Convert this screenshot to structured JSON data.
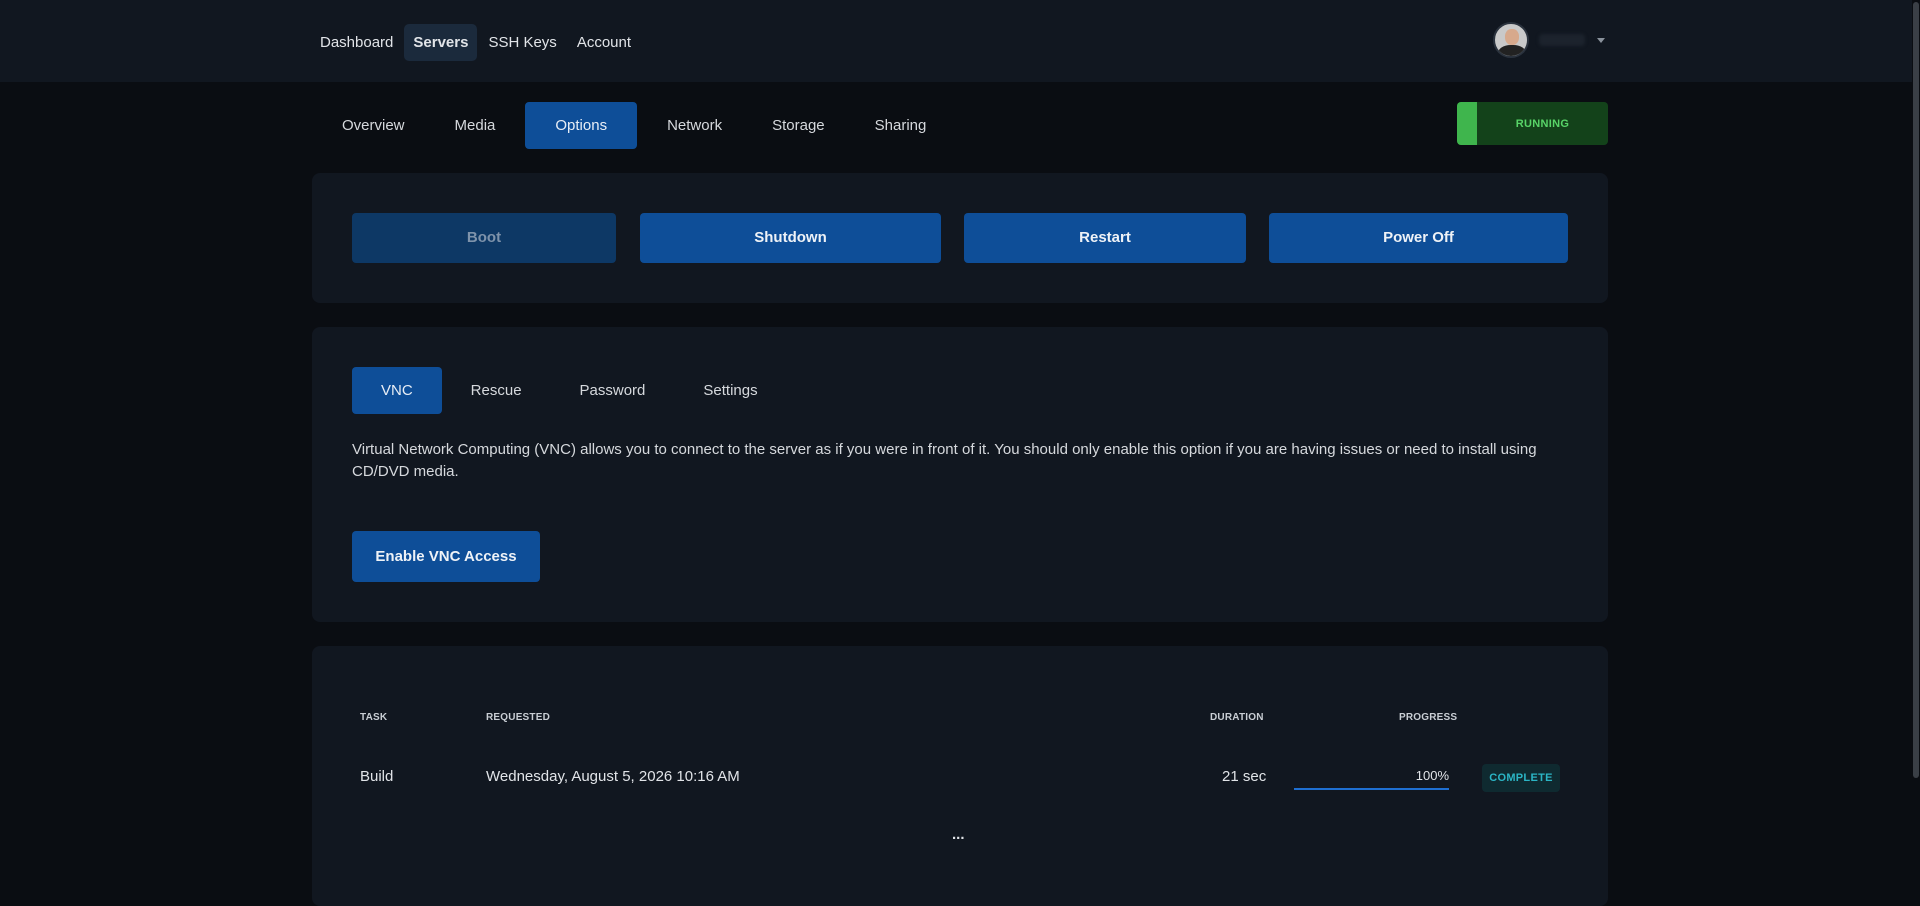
{
  "topnav": {
    "items": [
      "Dashboard",
      "Servers",
      "SSH Keys",
      "Account"
    ],
    "active": "Servers"
  },
  "user": {
    "avatar_icon": "user-avatar",
    "menu_icon": "chevron-down-icon"
  },
  "subtabs": {
    "items": [
      "Overview",
      "Media",
      "Options",
      "Network",
      "Storage",
      "Sharing"
    ],
    "active": "Options"
  },
  "status": {
    "label": "RUNNING",
    "color": "#3fb54d"
  },
  "power": {
    "boot": "Boot",
    "shutdown": "Shutdown",
    "restart": "Restart",
    "poweroff": "Power Off"
  },
  "vnc": {
    "tabs": [
      "VNC",
      "Rescue",
      "Password",
      "Settings"
    ],
    "active": "VNC",
    "description": "Virtual Network Computing (VNC) allows you to connect to the server as if you were in front of it. You should only enable this option if you are having issues or need to install using CD/DVD media.",
    "enable_label": "Enable VNC Access"
  },
  "tasks": {
    "headers": {
      "task": "TASK",
      "requested": "REQUESTED",
      "duration": "DURATION",
      "progress": "PROGRESS"
    },
    "rows": [
      {
        "task": "Build",
        "requested": "Wednesday, August 5, 2026 10:16 AM",
        "duration": "21 sec",
        "progress_text": "100%",
        "progress": 1.0,
        "status": "COMPLETE"
      }
    ],
    "more_label": "..."
  },
  "colors": {
    "accent": "#0e4e98",
    "background": "#0a0d12",
    "panel": "#111720"
  }
}
